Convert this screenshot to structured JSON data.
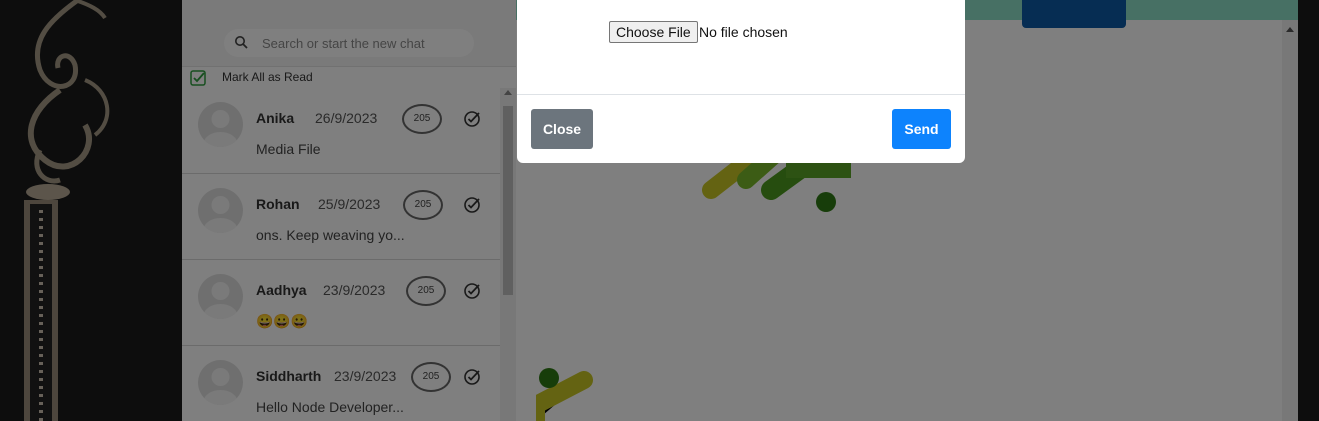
{
  "search": {
    "placeholder": "Search or start the new chat"
  },
  "mark_all": {
    "label": "Mark All as Read"
  },
  "chats": [
    {
      "name": "Anika",
      "date": "26/9/2023",
      "badge": "205",
      "preview": "Media File"
    },
    {
      "name": "Rohan",
      "date": "25/9/2023",
      "badge": "205",
      "preview": "ons. Keep weaving yo..."
    },
    {
      "name": "Aadhya",
      "date": "23/9/2023",
      "badge": "205",
      "preview": "😀😀😀"
    },
    {
      "name": "Siddharth",
      "date": "23/9/2023",
      "badge": "205",
      "preview": "Hello Node Developer..."
    }
  ],
  "modal": {
    "choose_file_label": "Choose File",
    "file_status": "No file chosen",
    "close_label": "Close",
    "send_label": "Send"
  },
  "colors": {
    "send_button": "#0d83fd",
    "close_button": "#6c757d",
    "header_accent": "#8fe0c8",
    "check_green": "#2e9e3e"
  }
}
